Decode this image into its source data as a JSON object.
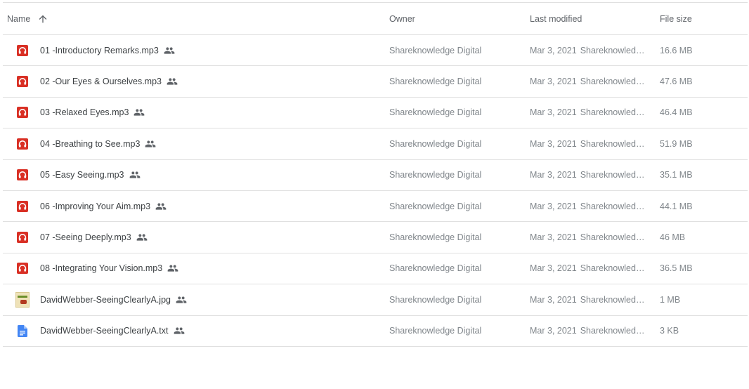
{
  "columns": {
    "name": "Name",
    "owner": "Owner",
    "last_modified": "Last modified",
    "file_size": "File size"
  },
  "sort": {
    "column": "Name",
    "direction": "ascending",
    "icon": "arrow-up-icon"
  },
  "colors": {
    "audio_icon": "#d93025",
    "doc_icon": "#4285f4",
    "divider": "#e0e0e0",
    "primary_text": "#3c4043",
    "secondary_text": "#80868b"
  },
  "files": [
    {
      "name": "01 -Introductory Remarks.mp3",
      "type": "audio",
      "icon": "headphones-icon",
      "shared": true,
      "owner": "Shareknowledge Digital",
      "modified_date": "Mar 3, 2021",
      "modified_by": "Shareknowledge Digital",
      "size": "16.6 MB"
    },
    {
      "name": "02 -Our Eyes & Ourselves.mp3",
      "type": "audio",
      "icon": "headphones-icon",
      "shared": true,
      "owner": "Shareknowledge Digital",
      "modified_date": "Mar 3, 2021",
      "modified_by": "Shareknowledge Digital",
      "size": "47.6 MB"
    },
    {
      "name": "03 -Relaxed Eyes.mp3",
      "type": "audio",
      "icon": "headphones-icon",
      "shared": true,
      "owner": "Shareknowledge Digital",
      "modified_date": "Mar 3, 2021",
      "modified_by": "Shareknowledge Digital",
      "size": "46.4 MB"
    },
    {
      "name": "04 -Breathing to See.mp3",
      "type": "audio",
      "icon": "headphones-icon",
      "shared": true,
      "owner": "Shareknowledge Digital",
      "modified_date": "Mar 3, 2021",
      "modified_by": "Shareknowledge Digital",
      "size": "51.9 MB"
    },
    {
      "name": "05 -Easy Seeing.mp3",
      "type": "audio",
      "icon": "headphones-icon",
      "shared": true,
      "owner": "Shareknowledge Digital",
      "modified_date": "Mar 3, 2021",
      "modified_by": "Shareknowledge Digital",
      "size": "35.1 MB"
    },
    {
      "name": "06 -Improving Your Aim.mp3",
      "type": "audio",
      "icon": "headphones-icon",
      "shared": true,
      "owner": "Shareknowledge Digital",
      "modified_date": "Mar 3, 2021",
      "modified_by": "Shareknowledge Digital",
      "size": "44.1 MB"
    },
    {
      "name": "07 -Seeing Deeply.mp3",
      "type": "audio",
      "icon": "headphones-icon",
      "shared": true,
      "owner": "Shareknowledge Digital",
      "modified_date": "Mar 3, 2021",
      "modified_by": "Shareknowledge Digital",
      "size": "46 MB"
    },
    {
      "name": "08 -Integrating Your Vision.mp3",
      "type": "audio",
      "icon": "headphones-icon",
      "shared": true,
      "owner": "Shareknowledge Digital",
      "modified_date": "Mar 3, 2021",
      "modified_by": "Shareknowledge Digital",
      "size": "36.5 MB"
    },
    {
      "name": "DavidWebber-SeeingClearlyA.jpg",
      "type": "image",
      "icon": "image-thumbnail",
      "shared": true,
      "owner": "Shareknowledge Digital",
      "modified_date": "Mar 3, 2021",
      "modified_by": "Shareknowledge Digital",
      "size": "1 MB"
    },
    {
      "name": "DavidWebber-SeeingClearlyA.txt",
      "type": "document",
      "icon": "document-icon",
      "shared": true,
      "owner": "Shareknowledge Digital",
      "modified_date": "Mar 3, 2021",
      "modified_by": "Shareknowledge Digital",
      "size": "3 KB"
    }
  ]
}
